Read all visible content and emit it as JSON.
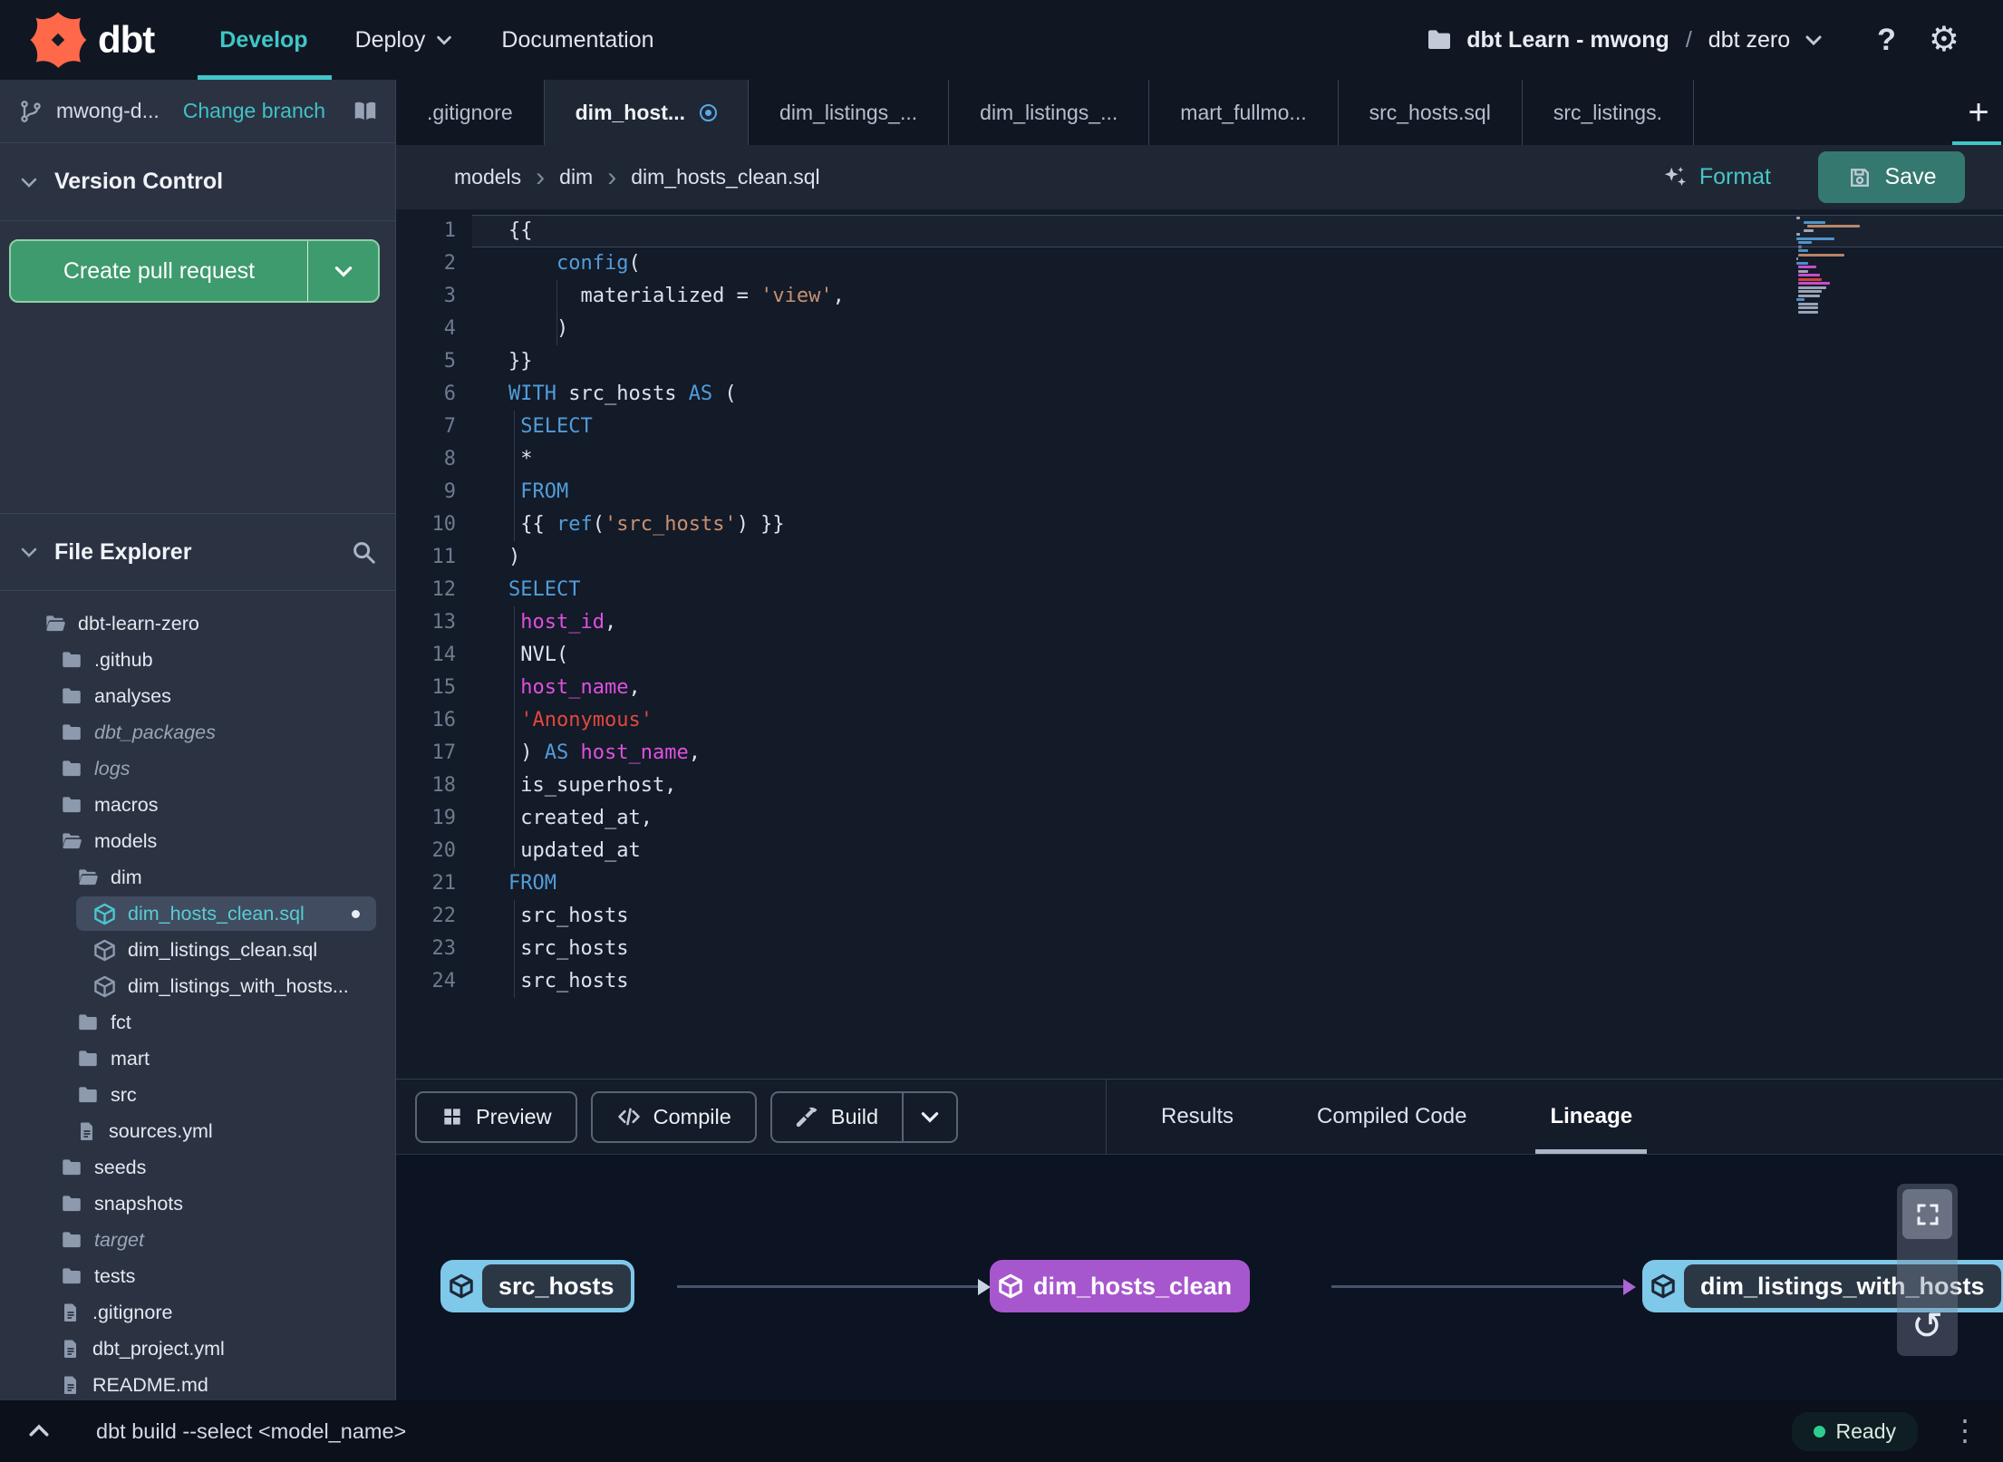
{
  "navbar": {
    "brand": "dbt",
    "items": [
      {
        "label": "Develop",
        "active": true,
        "dropdown": false
      },
      {
        "label": "Deploy",
        "active": false,
        "dropdown": true
      },
      {
        "label": "Documentation",
        "active": false,
        "dropdown": false
      }
    ],
    "account": "dbt Learn - mwong",
    "separator": "/",
    "project": "dbt zero"
  },
  "sidebar": {
    "branch": {
      "name": "mwong-d...",
      "change_label": "Change branch"
    },
    "version_control": {
      "title": "Version Control",
      "create_pr_label": "Create pull request"
    },
    "file_explorer": {
      "title": "File Explorer",
      "tree": [
        {
          "label": "dbt-learn-zero",
          "type": "folder-open",
          "depth": 0
        },
        {
          "label": ".github",
          "type": "folder",
          "depth": 1
        },
        {
          "label": "analyses",
          "type": "folder",
          "depth": 1
        },
        {
          "label": "dbt_packages",
          "type": "folder",
          "depth": 1,
          "italic": true
        },
        {
          "label": "logs",
          "type": "folder",
          "depth": 1,
          "italic": true
        },
        {
          "label": "macros",
          "type": "folder",
          "depth": 1
        },
        {
          "label": "models",
          "type": "folder-open",
          "depth": 1
        },
        {
          "label": "dim",
          "type": "folder-open",
          "depth": 2
        },
        {
          "label": "dim_hosts_clean.sql",
          "type": "model",
          "depth": 3,
          "selected": true,
          "modified": true
        },
        {
          "label": "dim_listings_clean.sql",
          "type": "model",
          "depth": 3
        },
        {
          "label": "dim_listings_with_hosts...",
          "type": "model",
          "depth": 3
        },
        {
          "label": "fct",
          "type": "folder",
          "depth": 2
        },
        {
          "label": "mart",
          "type": "folder",
          "depth": 2
        },
        {
          "label": "src",
          "type": "folder",
          "depth": 2
        },
        {
          "label": "sources.yml",
          "type": "file",
          "depth": 2
        },
        {
          "label": "seeds",
          "type": "folder",
          "depth": 1
        },
        {
          "label": "snapshots",
          "type": "folder",
          "depth": 1
        },
        {
          "label": "target",
          "type": "folder",
          "depth": 1,
          "italic": true
        },
        {
          "label": "tests",
          "type": "folder",
          "depth": 1
        },
        {
          "label": ".gitignore",
          "type": "file",
          "depth": 1
        },
        {
          "label": "dbt_project.yml",
          "type": "file",
          "depth": 1
        },
        {
          "label": "README.md",
          "type": "file",
          "depth": 1
        }
      ]
    }
  },
  "tabs": [
    {
      "label": ".gitignore",
      "active": false,
      "modified": false
    },
    {
      "label": "dim_host...",
      "active": true,
      "modified": true
    },
    {
      "label": "dim_listings_...",
      "active": false,
      "modified": false
    },
    {
      "label": "dim_listings_...",
      "active": false,
      "modified": false
    },
    {
      "label": "mart_fullmo...",
      "active": false,
      "modified": false
    },
    {
      "label": "src_hosts.sql",
      "active": false,
      "modified": false
    },
    {
      "label": "src_listings.",
      "active": false,
      "modified": false
    }
  ],
  "editor": {
    "breadcrumb": [
      "models",
      "dim",
      "dim_hosts_clean.sql"
    ],
    "format_label": "Format",
    "save_label": "Save",
    "lines": [
      {
        "n": 1,
        "current": true,
        "tokens": [
          [
            "{{",
            "p"
          ]
        ]
      },
      {
        "n": 2,
        "tokens": [
          [
            "    ",
            "p"
          ],
          [
            "config",
            "k"
          ],
          [
            "(",
            "p"
          ]
        ]
      },
      {
        "n": 3,
        "guide": "g2",
        "tokens": [
          [
            "      ",
            "p"
          ],
          [
            "materialized = ",
            "p"
          ],
          [
            "'view'",
            "s"
          ],
          [
            ",",
            "p"
          ]
        ]
      },
      {
        "n": 4,
        "guide": "g2",
        "tokens": [
          [
            "    )",
            "p"
          ]
        ]
      },
      {
        "n": 5,
        "tokens": [
          [
            "}}",
            "p"
          ]
        ]
      },
      {
        "n": 6,
        "tokens": [
          [
            "WITH",
            "k"
          ],
          [
            " src_hosts ",
            "p"
          ],
          [
            "AS",
            "k"
          ],
          [
            " (",
            "p"
          ]
        ]
      },
      {
        "n": 7,
        "guide": "g1",
        "tokens": [
          [
            " ",
            "p"
          ],
          [
            "SELECT",
            "k"
          ]
        ]
      },
      {
        "n": 8,
        "guide": "g1",
        "tokens": [
          [
            " *",
            "p"
          ]
        ]
      },
      {
        "n": 9,
        "guide": "g1",
        "tokens": [
          [
            " ",
            "p"
          ],
          [
            "FROM",
            "k"
          ]
        ]
      },
      {
        "n": 10,
        "guide": "g1",
        "tokens": [
          [
            " {{ ",
            "p"
          ],
          [
            "ref",
            "k"
          ],
          [
            "(",
            "p"
          ],
          [
            "'src_hosts'",
            "s"
          ],
          [
            ") }}",
            "p"
          ]
        ]
      },
      {
        "n": 11,
        "tokens": [
          [
            ")",
            "p"
          ]
        ]
      },
      {
        "n": 12,
        "tokens": [
          [
            "SELECT",
            "k"
          ]
        ]
      },
      {
        "n": 13,
        "guide": "g1",
        "tokens": [
          [
            " ",
            "p"
          ],
          [
            "host_id",
            "m"
          ],
          [
            ",",
            "p"
          ]
        ]
      },
      {
        "n": 14,
        "guide": "g1",
        "tokens": [
          [
            " NVL(",
            "p"
          ]
        ]
      },
      {
        "n": 15,
        "guide": "g1",
        "tokens": [
          [
            " ",
            "p"
          ],
          [
            "host_name",
            "m"
          ],
          [
            ",",
            "p"
          ]
        ]
      },
      {
        "n": 16,
        "guide": "g1",
        "tokens": [
          [
            " ",
            "p"
          ],
          [
            "'Anonymous'",
            "r"
          ]
        ]
      },
      {
        "n": 17,
        "guide": "g1",
        "tokens": [
          [
            " ) ",
            "p"
          ],
          [
            "AS",
            "k"
          ],
          [
            " ",
            "p"
          ],
          [
            "host_name",
            "m"
          ],
          [
            ",",
            "p"
          ]
        ]
      },
      {
        "n": 18,
        "guide": "g1",
        "tokens": [
          [
            " is_superhost,",
            "p"
          ]
        ]
      },
      {
        "n": 19,
        "guide": "g1",
        "tokens": [
          [
            " created_at,",
            "p"
          ]
        ]
      },
      {
        "n": 20,
        "guide": "g1",
        "tokens": [
          [
            " updated_at",
            "p"
          ]
        ]
      },
      {
        "n": 21,
        "tokens": [
          [
            "FROM",
            "k"
          ]
        ]
      },
      {
        "n": 22,
        "guide": "g1",
        "tokens": [
          [
            " src_hosts",
            "p"
          ]
        ]
      },
      {
        "n": 23,
        "guide": "g1",
        "tokens": [
          [
            " src_hosts",
            "p"
          ]
        ]
      },
      {
        "n": 24,
        "guide": "g1",
        "tokens": [
          [
            " src_hosts",
            "p"
          ]
        ]
      }
    ]
  },
  "bottom": {
    "preview_label": "Preview",
    "compile_label": "Compile",
    "build_label": "Build",
    "tabs": [
      {
        "label": "Results",
        "active": false
      },
      {
        "label": "Compiled Code",
        "active": false
      },
      {
        "label": "Lineage",
        "active": true
      }
    ]
  },
  "lineage": {
    "nodes": [
      {
        "label": "src_hosts",
        "color": "blue"
      },
      {
        "label": "dim_hosts_clean",
        "color": "purple"
      },
      {
        "label": "dim_listings_with_hosts",
        "color": "blue"
      }
    ]
  },
  "statusbar": {
    "command": "dbt build --select <model_name>",
    "status": "Ready"
  },
  "colors": {
    "accent_teal": "#3fc6c8",
    "green_button": "#3e9b6d",
    "save_button": "#34786f",
    "selected_file_teal": "#57cdd2",
    "node_purple": "#a757ce",
    "node_blue": "#7ec8ea",
    "keyword_blue": "#519dd9",
    "string_orange": "#c9906f",
    "string_red": "#e2483d",
    "identifier_magenta": "#de51de",
    "modified_dot_blue": "#5aa7e8",
    "ready_green": "#2ecc8f",
    "logo_orange": "#ff6949"
  }
}
